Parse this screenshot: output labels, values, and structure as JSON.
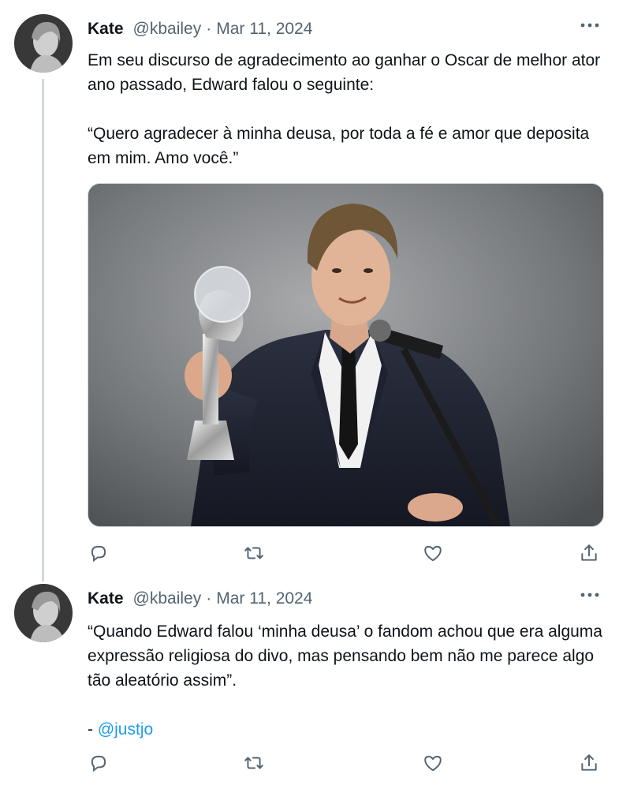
{
  "tweets": [
    {
      "author_name": "Kate",
      "handle": "@kbailey",
      "separator": "·",
      "date": "Mar 11, 2024",
      "paragraphs": [
        "Em seu discurso de agradecimento ao ganhar o Oscar de melhor ator ano passado, Edward falou o seguinte:",
        "“Quero agradecer à minha deusa, por toda a fé e amor que deposita em mim. Amo você.”"
      ],
      "has_media": true
    },
    {
      "author_name": "Kate",
      "handle": "@kbailey",
      "separator": "·",
      "date": "Mar 11, 2024",
      "paragraphs": [
        "“Quando Edward falou ‘minha deusa’ o fandom achou que era alguma expressão religiosa do divo, mas pensando bem não me parece algo tão aleatório assim”."
      ],
      "signature_prefix": "- ",
      "signature_mention": "@justjo"
    }
  ],
  "icons": {
    "more": "more-horizontal-icon",
    "reply": "reply-icon",
    "retweet": "retweet-icon",
    "like": "heart-icon",
    "share": "share-icon"
  },
  "colors": {
    "text": "#0f1419",
    "secondary": "#536471",
    "link": "#1d9bf0",
    "thread_line": "#cfd9de"
  }
}
